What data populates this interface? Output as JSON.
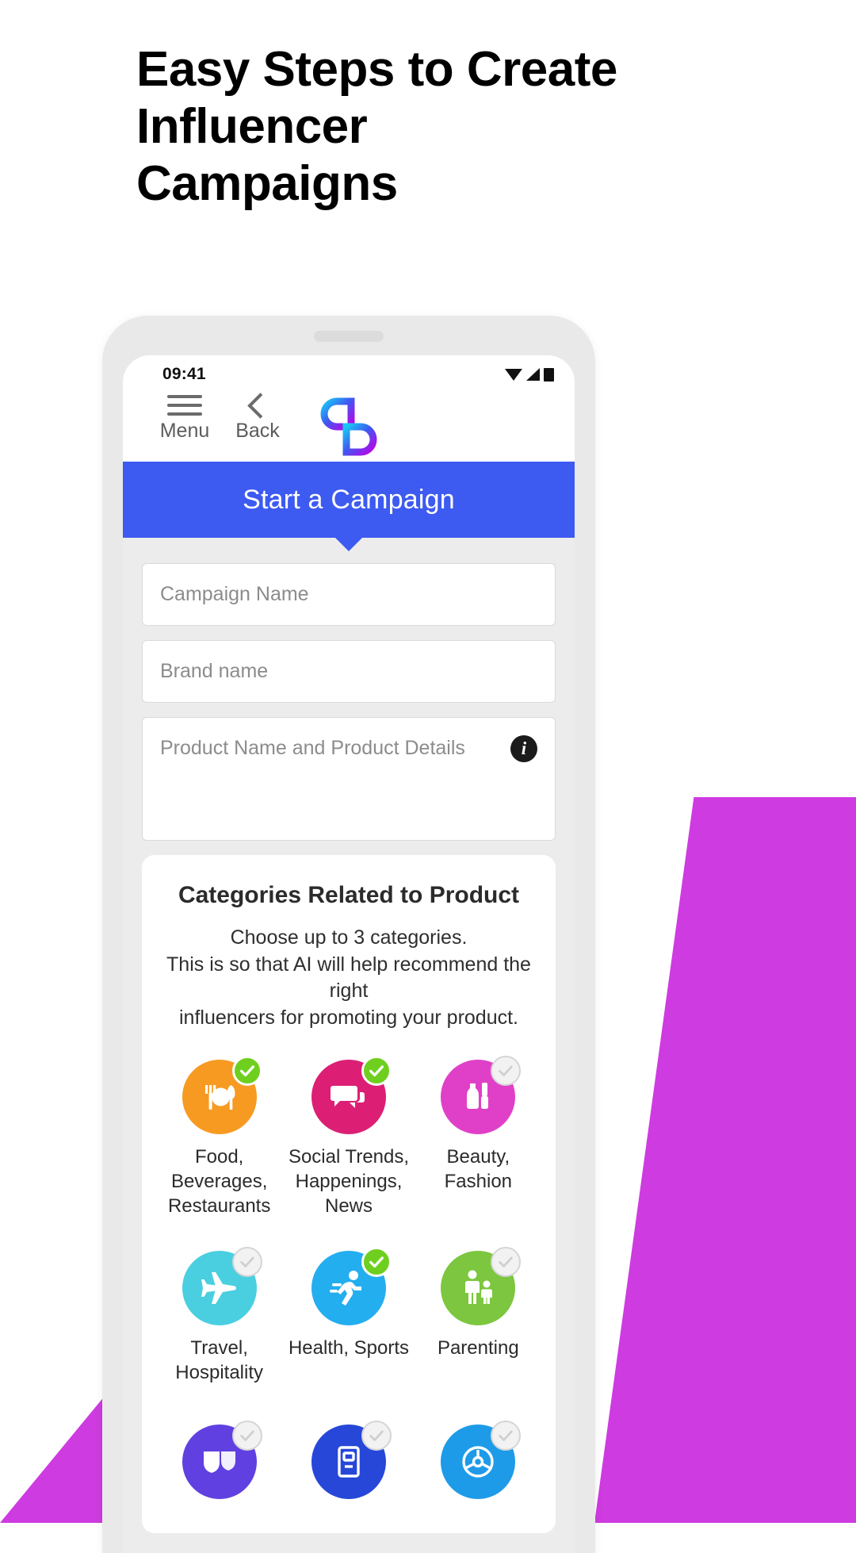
{
  "headline": "Easy Steps to Create Influencer Campaigns",
  "colors": {
    "accent_blue": "#3D5AF1",
    "deco_magenta": "#CE3BE0",
    "check_green": "#6FCF1E",
    "logo_cyan": "#19C8F5",
    "logo_magenta": "#C000E8"
  },
  "phone": {
    "statusbar": {
      "time": "09:41",
      "icons": [
        "wifi-icon",
        "signal-icon",
        "battery-icon"
      ]
    },
    "appbar": {
      "menu_label": "Menu",
      "back_label": "Back",
      "logo_name": "brand-logo"
    },
    "banner": {
      "label": "Start a Campaign"
    },
    "form": {
      "campaign_name": {
        "value": "",
        "placeholder": "Campaign Name"
      },
      "brand_name": {
        "value": "",
        "placeholder": "Brand name"
      },
      "product_details": {
        "value": "",
        "placeholder": "Product Name and Product Details",
        "info_glyph": "i"
      }
    },
    "categories": {
      "title": "Categories Related to Product",
      "subtitle_line1": "Choose up to 3 categories.",
      "subtitle_line2": "This is so that AI will help recommend the right",
      "subtitle_line3": "influencers for promoting your product.",
      "items": [
        {
          "label": "Food, Beverages, Restaurants",
          "icon": "cutlery-icon",
          "color": "#F79A22",
          "selected": true
        },
        {
          "label": "Social Trends, Happenings, News",
          "icon": "chat-bubbles-icon",
          "color": "#DC1F74",
          "selected": true
        },
        {
          "label": "Beauty, Fashion",
          "icon": "cosmetics-icon",
          "color": "#E040C8",
          "selected": false
        },
        {
          "label": "Travel, Hospitality",
          "icon": "airplane-icon",
          "color": "#4ACFE0",
          "selected": false
        },
        {
          "label": "Health, Sports",
          "icon": "runner-icon",
          "color": "#23AEEF",
          "selected": true
        },
        {
          "label": "Parenting",
          "icon": "parent-child-icon",
          "color": "#7DC63F",
          "selected": false
        },
        {
          "label": "",
          "icon": "theatre-masks-icon",
          "color": "#6040E0",
          "selected": false
        },
        {
          "label": "",
          "icon": "building-icon",
          "color": "#2647D8",
          "selected": false
        },
        {
          "label": "",
          "icon": "steering-wheel-icon",
          "color": "#1D9BE8",
          "selected": false
        }
      ]
    }
  }
}
